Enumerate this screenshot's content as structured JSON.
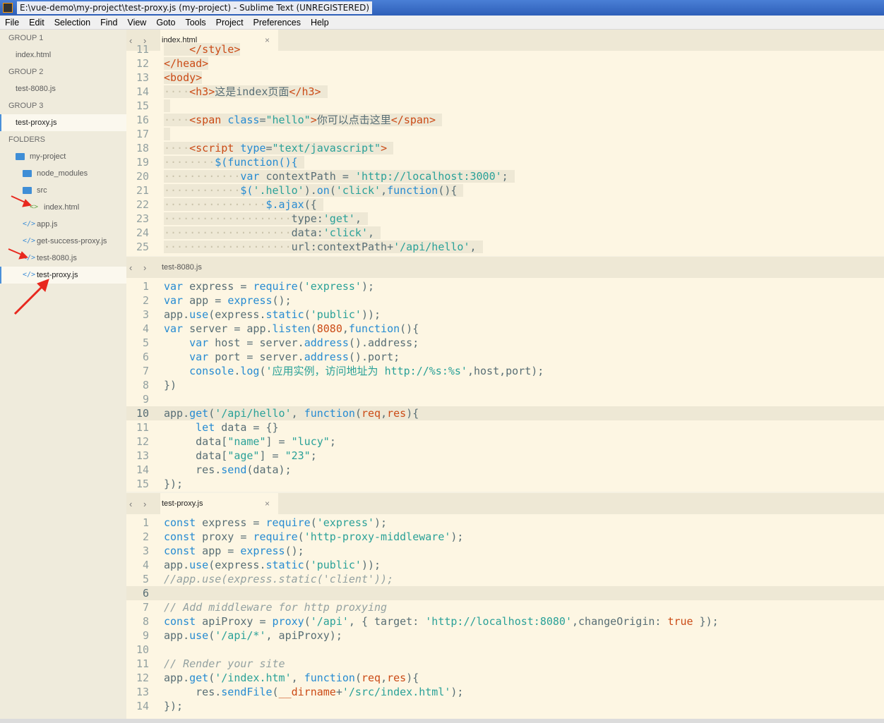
{
  "window": {
    "title": "E:\\vue-demo\\my-project\\test-proxy.js (my-project) - Sublime Text (UNREGISTERED)"
  },
  "menu": [
    "File",
    "Edit",
    "Selection",
    "Find",
    "View",
    "Goto",
    "Tools",
    "Project",
    "Preferences",
    "Help"
  ],
  "sidebar": {
    "groups": [
      {
        "label": "GROUP 1",
        "file": "index.html"
      },
      {
        "label": "GROUP 2",
        "file": "test-8080.js"
      },
      {
        "label": "GROUP 3",
        "file": "test-proxy.js"
      }
    ],
    "folders_label": "FOLDERS",
    "project": "my-project",
    "node_modules": "node_modules",
    "src": "src",
    "src_file": "index.html",
    "files": [
      "app.js",
      "get-success-proxy.js",
      "test-8080.js",
      "test-proxy.js"
    ]
  },
  "panes": [
    {
      "tab": "index.html",
      "close": "×"
    },
    {
      "tab": "test-8080.js"
    },
    {
      "tab": "test-proxy.js",
      "close": "×"
    }
  ],
  "nav_arrows": "‹ ›",
  "annotation_color": "#e8281e"
}
